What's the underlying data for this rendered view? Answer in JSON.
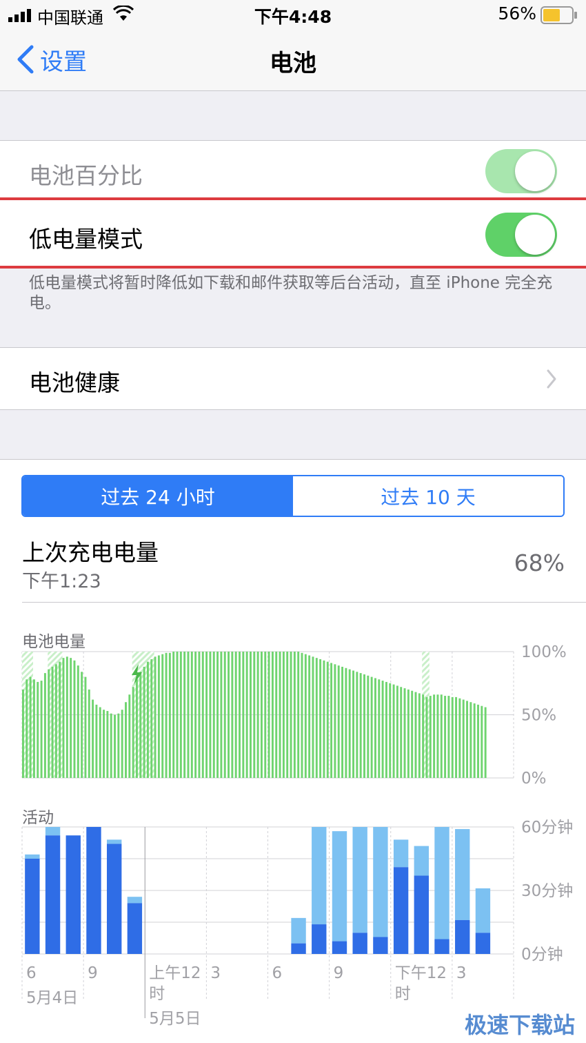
{
  "status_bar": {
    "carrier": "中国联通",
    "time": "下午4:48",
    "battery_percent": "56%"
  },
  "nav": {
    "back_label": "设置",
    "title": "电池"
  },
  "settings": {
    "battery_percentage_label": "电池百分比",
    "battery_percentage_on": true,
    "low_power_label": "低电量模式",
    "low_power_on": true,
    "low_power_footnote": "低电量模式将暂时降低如下载和邮件获取等后台活动，直至 iPhone 完全充电。",
    "battery_health_label": "电池健康"
  },
  "segment": {
    "tab_24h": "过去 24 小时",
    "tab_10d": "过去 10 天",
    "selected": "tab_24h"
  },
  "last_charge": {
    "label": "上次充电电量",
    "time": "下午1:23",
    "value": "68%"
  },
  "chart_data": [
    {
      "type": "bar",
      "title": "电池电量",
      "y_tick_labels": [
        "100%",
        "50%",
        "0%"
      ],
      "ylim": [
        0,
        100
      ],
      "unit": "%",
      "color": "#6fd46f",
      "charging_color": "#c9efc9",
      "charging_ranges": [
        [
          0,
          2
        ],
        [
          7,
          10
        ],
        [
          30,
          35
        ],
        [
          109,
          110
        ]
      ],
      "charging_icon_at": 31,
      "values": [
        70,
        78,
        80,
        78,
        76,
        77,
        83,
        86,
        88,
        90,
        92,
        95,
        96,
        95,
        93,
        89,
        84,
        80,
        70,
        62,
        58,
        56,
        54,
        53,
        51,
        50,
        51,
        54,
        60,
        66,
        72,
        78,
        84,
        88,
        92,
        94,
        96,
        97,
        98,
        99,
        99,
        100,
        100,
        100,
        100,
        100,
        100,
        100,
        100,
        100,
        100,
        100,
        100,
        100,
        100,
        100,
        100,
        100,
        100,
        100,
        100,
        100,
        100,
        100,
        100,
        100,
        100,
        100,
        100,
        100,
        100,
        100,
        100,
        100,
        100,
        100,
        99,
        98,
        97,
        96,
        95,
        94,
        93,
        92,
        91,
        90,
        89,
        88,
        87,
        86,
        85,
        84,
        83,
        82,
        81,
        80,
        79,
        78,
        77,
        76,
        75,
        74,
        73,
        72,
        71,
        70,
        69,
        68,
        67,
        66,
        64,
        65,
        66,
        66,
        66,
        65,
        65,
        64,
        64,
        63,
        62,
        61,
        60,
        59,
        58,
        57,
        56
      ]
    },
    {
      "type": "bar",
      "title": "活动",
      "stacked": true,
      "ylim": [
        0,
        60
      ],
      "y_tick_labels": [
        "60分钟",
        "30分钟",
        "0分钟"
      ],
      "series": [
        {
          "color": "#2f6de6",
          "values": [
            45,
            56,
            56,
            60,
            52,
            24,
            0,
            0,
            0,
            0,
            0,
            0,
            0,
            5,
            14,
            6,
            10,
            8,
            41,
            37,
            7,
            16,
            10
          ]
        },
        {
          "color": "#7cc1f2",
          "values": [
            2,
            4,
            0,
            0,
            2,
            3,
            0,
            0,
            0,
            0,
            0,
            0,
            0,
            12,
            46,
            52,
            50,
            52,
            13,
            14,
            53,
            43,
            21
          ]
        }
      ]
    }
  ],
  "time_axis": {
    "hour_labels": [
      "6",
      "9",
      "上午12",
      "3",
      "6",
      "9",
      "下午12",
      "3"
    ],
    "hour_label_suffix": "时",
    "date_labels": [
      "5月4日",
      "5月5日"
    ]
  },
  "watermark": "极速下载站"
}
